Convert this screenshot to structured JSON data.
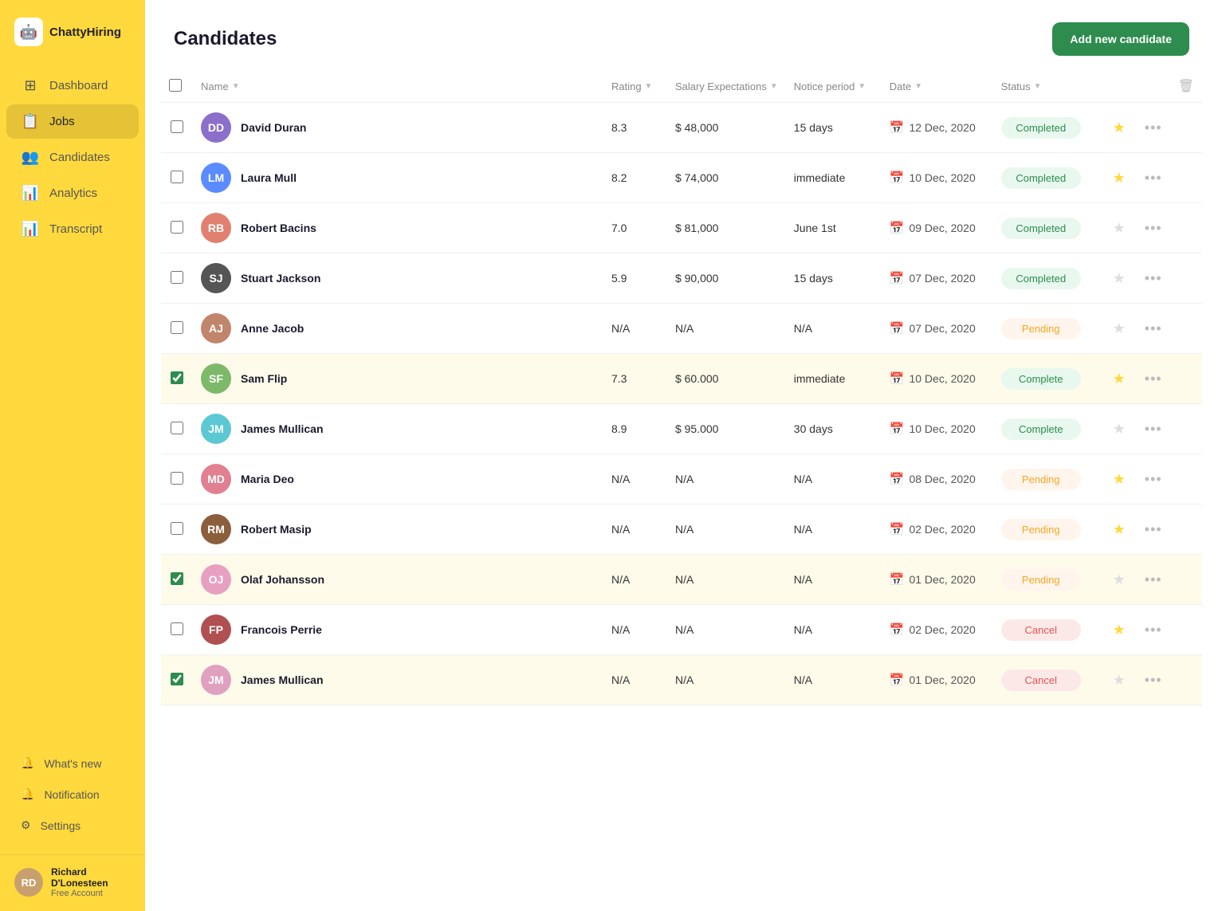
{
  "app": {
    "name": "ChattyHiring",
    "logo_emoji": "🤖"
  },
  "sidebar": {
    "items": [
      {
        "id": "dashboard",
        "label": "Dashboard",
        "icon": "⊞",
        "active": false
      },
      {
        "id": "jobs",
        "label": "Jobs",
        "icon": "📋",
        "active": true
      },
      {
        "id": "candidates",
        "label": "Candidates",
        "icon": "👥",
        "active": false
      },
      {
        "id": "analytics",
        "label": "Analytics",
        "icon": "📊",
        "active": false
      },
      {
        "id": "transcript",
        "label": "Transcript",
        "icon": "📊",
        "active": false
      }
    ],
    "bottom_items": [
      {
        "id": "whats-new",
        "label": "What's new",
        "icon": "🔔"
      },
      {
        "id": "notification",
        "label": "Notification",
        "icon": "🔔"
      },
      {
        "id": "settings",
        "label": "Settings",
        "icon": "⚙"
      }
    ],
    "user": {
      "name": "Richard D'Lonesteen",
      "role": "Free Account"
    }
  },
  "header": {
    "title": "Candidates",
    "add_button_label": "Add new candidate"
  },
  "table": {
    "columns": [
      {
        "id": "check",
        "label": ""
      },
      {
        "id": "name",
        "label": "Name",
        "sortable": true
      },
      {
        "id": "rating",
        "label": "Rating",
        "sortable": true
      },
      {
        "id": "salary",
        "label": "Salary Expectations",
        "sortable": true
      },
      {
        "id": "notice",
        "label": "Notice period",
        "sortable": true
      },
      {
        "id": "date",
        "label": "Date",
        "sortable": true
      },
      {
        "id": "status",
        "label": "Status",
        "sortable": true
      },
      {
        "id": "star",
        "label": ""
      },
      {
        "id": "more",
        "label": ""
      },
      {
        "id": "trash",
        "label": "🗑"
      }
    ],
    "rows": [
      {
        "id": 1,
        "name": "David Duran",
        "rating": "8.3",
        "salary": "$ 48,000",
        "notice": "15 days",
        "date": "12 Dec, 2020",
        "status": "Completed",
        "status_type": "completed",
        "starred": true,
        "checked": false,
        "color": "#8b6fcb"
      },
      {
        "id": 2,
        "name": "Laura Mull",
        "rating": "8.2",
        "salary": "$ 74,000",
        "notice": "immediate",
        "date": "10 Dec, 2020",
        "status": "Completed",
        "status_type": "completed",
        "starred": true,
        "checked": false,
        "color": "#5b8cff"
      },
      {
        "id": 3,
        "name": "Robert Bacins",
        "rating": "7.0",
        "salary": "$ 81,000",
        "notice": "June 1st",
        "date": "09 Dec, 2020",
        "status": "Completed",
        "status_type": "completed",
        "starred": false,
        "checked": false,
        "color": "#e08070"
      },
      {
        "id": 4,
        "name": "Stuart Jackson",
        "rating": "5.9",
        "salary": "$ 90,000",
        "notice": "15 days",
        "date": "07 Dec, 2020",
        "status": "Completed",
        "status_type": "completed",
        "starred": false,
        "checked": false,
        "color": "#555"
      },
      {
        "id": 5,
        "name": "Anne Jacob",
        "rating": "N/A",
        "salary": "N/A",
        "notice": "N/A",
        "date": "07 Dec, 2020",
        "status": "Pending",
        "status_type": "pending",
        "starred": false,
        "checked": false,
        "color": "#c0856b"
      },
      {
        "id": 6,
        "name": "Sam Flip",
        "rating": "7.3",
        "salary": "$ 60.000",
        "notice": "immediate",
        "date": "10 Dec, 2020",
        "status": "Complete",
        "status_type": "complete",
        "starred": true,
        "checked": true,
        "color": "#7cba6a"
      },
      {
        "id": 7,
        "name": "James Mullican",
        "rating": "8.9",
        "salary": "$ 95.000",
        "notice": "30 days",
        "date": "10 Dec, 2020",
        "status": "Complete",
        "status_type": "complete",
        "starred": false,
        "checked": false,
        "color": "#5bc8d4"
      },
      {
        "id": 8,
        "name": "Maria Deo",
        "rating": "N/A",
        "salary": "N/A",
        "notice": "N/A",
        "date": "08 Dec, 2020",
        "status": "Pending",
        "status_type": "pending",
        "starred": true,
        "checked": false,
        "color": "#e08090"
      },
      {
        "id": 9,
        "name": "Robert Masip",
        "rating": "N/A",
        "salary": "N/A",
        "notice": "N/A",
        "date": "02 Dec, 2020",
        "status": "Pending",
        "status_type": "pending",
        "starred": true,
        "checked": false,
        "color": "#8b5e3c"
      },
      {
        "id": 10,
        "name": "Olaf Johansson",
        "rating": "N/A",
        "salary": "N/A",
        "notice": "N/A",
        "date": "01 Dec, 2020",
        "status": "Pending",
        "status_type": "pending",
        "starred": false,
        "checked": true,
        "color": "#e8a0c0"
      },
      {
        "id": 11,
        "name": "Francois Perrie",
        "rating": "N/A",
        "salary": "N/A",
        "notice": "N/A",
        "date": "02 Dec, 2020",
        "status": "Cancel",
        "status_type": "cancel",
        "starred": true,
        "checked": false,
        "color": "#b05050"
      },
      {
        "id": 12,
        "name": "James Mullican",
        "rating": "N/A",
        "salary": "N/A",
        "notice": "N/A",
        "date": "01 Dec, 2020",
        "status": "Cancel",
        "status_type": "cancel",
        "starred": false,
        "checked": true,
        "color": "#e0a0c0"
      }
    ]
  }
}
